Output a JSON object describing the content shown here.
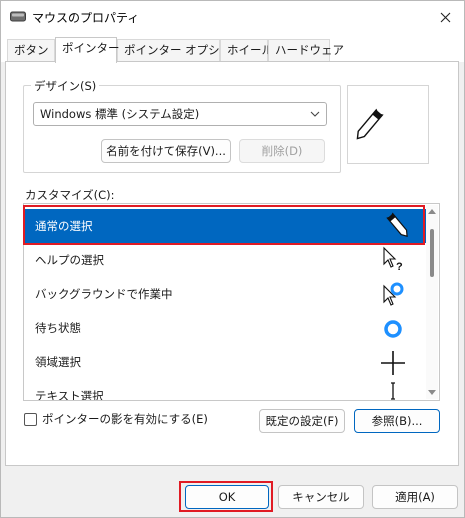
{
  "window": {
    "title": "マウスのプロパティ",
    "icon": "mouse-icon",
    "close_icon": "close-icon"
  },
  "tabs": [
    {
      "label": "ボタン",
      "active": false
    },
    {
      "label": "ポインター",
      "active": true
    },
    {
      "label": "ポインター オプション",
      "active": false
    },
    {
      "label": "ホイール",
      "active": false
    },
    {
      "label": "ハードウェア",
      "active": false
    }
  ],
  "design": {
    "group_label": "デザイン(S)",
    "scheme_value": "Windows 標準 (システム設定)",
    "save_as_label": "名前を付けて保存(V)...",
    "delete_label": "削除(D)"
  },
  "customize": {
    "label": "カスタマイズ(C):",
    "items": [
      {
        "label": "通常の選択",
        "cursor": "normal-select-cursor-icon",
        "selected": true
      },
      {
        "label": "ヘルプの選択",
        "cursor": "help-select-cursor-icon",
        "selected": false
      },
      {
        "label": "バックグラウンドで作業中",
        "cursor": "working-in-background-cursor-icon",
        "selected": false
      },
      {
        "label": "待ち状態",
        "cursor": "busy-cursor-icon",
        "selected": false
      },
      {
        "label": "領域選択",
        "cursor": "precision-select-cursor-icon",
        "selected": false
      },
      {
        "label": "テキスト選択",
        "cursor": "text-select-cursor-icon",
        "selected": false
      }
    ]
  },
  "options": {
    "shadow_label": "ポインターの影を有効にする(E)",
    "shadow_checked": false,
    "default_label": "既定の設定(F)",
    "browse_label": "参照(B)..."
  },
  "footer": {
    "ok_label": "OK",
    "cancel_label": "キャンセル",
    "apply_label": "適用(A)"
  },
  "colors": {
    "accent": "#0067c0",
    "highlight": "#e01b24",
    "busy_ring": "#1e90ff"
  }
}
